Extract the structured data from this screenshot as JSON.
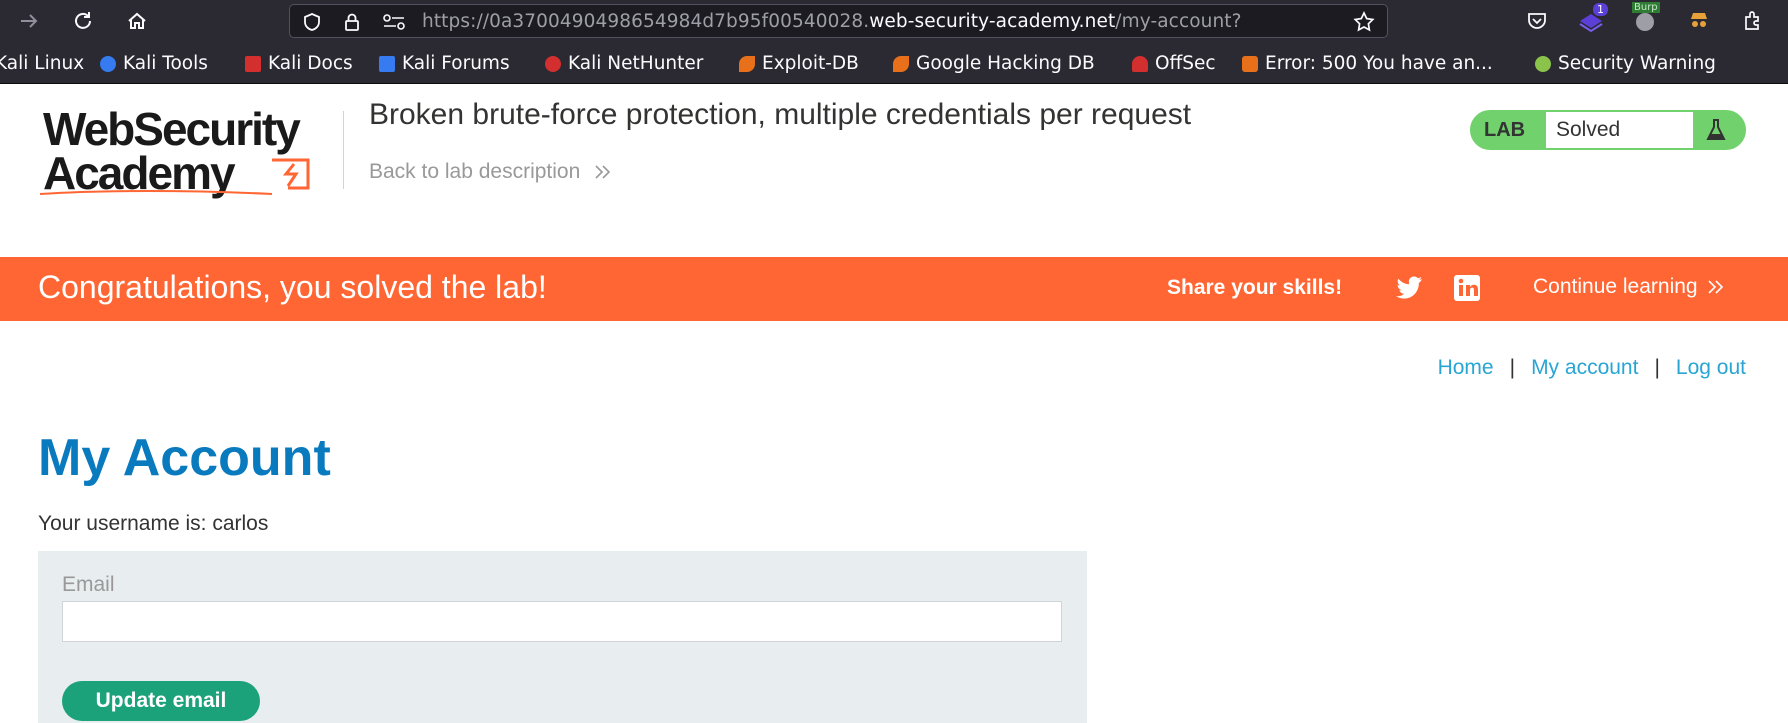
{
  "browser": {
    "url_prefix": "https://0a3700490498654984d7b95f00540028.",
    "url_domain": "web-security-academy.net",
    "url_path": "/my-account?",
    "bookmarks": [
      {
        "label": "Kali Linux",
        "color": "#367bf0"
      },
      {
        "label": "Kali Tools",
        "color": "#367bf0"
      },
      {
        "label": "Kali Docs",
        "color": "#d32f2f"
      },
      {
        "label": "Kali Forums",
        "color": "#367bf0"
      },
      {
        "label": "Kali NetHunter",
        "color": "#d32f2f"
      },
      {
        "label": "Exploit-DB",
        "color": "#e8701a"
      },
      {
        "label": "Google Hacking DB",
        "color": "#e8701a"
      },
      {
        "label": "OffSec",
        "color": "#d32f2f"
      },
      {
        "label": "Error: 500 You have an...",
        "color": "#e8701a"
      },
      {
        "label": "Security Warning",
        "color": "#8bc34a"
      }
    ],
    "extension_badge": "1",
    "burp_label": "Burp"
  },
  "header": {
    "logo_line1": "WebSecurity",
    "logo_line2": "Academy",
    "lab_title": "Broken brute-force protection, multiple credentials per request",
    "back_link": "Back to lab description",
    "lab_badge_label": "LAB",
    "lab_status": "Solved"
  },
  "banner": {
    "title": "Congratulations, you solved the lab!",
    "share_label": "Share your skills!",
    "continue_label": "Continue learning"
  },
  "nav": {
    "home": "Home",
    "separator": "|",
    "my_account": "My account",
    "log_out": "Log out"
  },
  "main": {
    "page_title": "My Account",
    "username_line": "Your username is: carlos",
    "email_label": "Email",
    "email_value": "",
    "update_button": "Update email"
  },
  "colors": {
    "accent_orange": "#ff6633",
    "link_blue": "#29a5d4",
    "title_blue": "#0a7abf",
    "lab_green": "#70d16d",
    "button_green": "#1ba27a"
  }
}
